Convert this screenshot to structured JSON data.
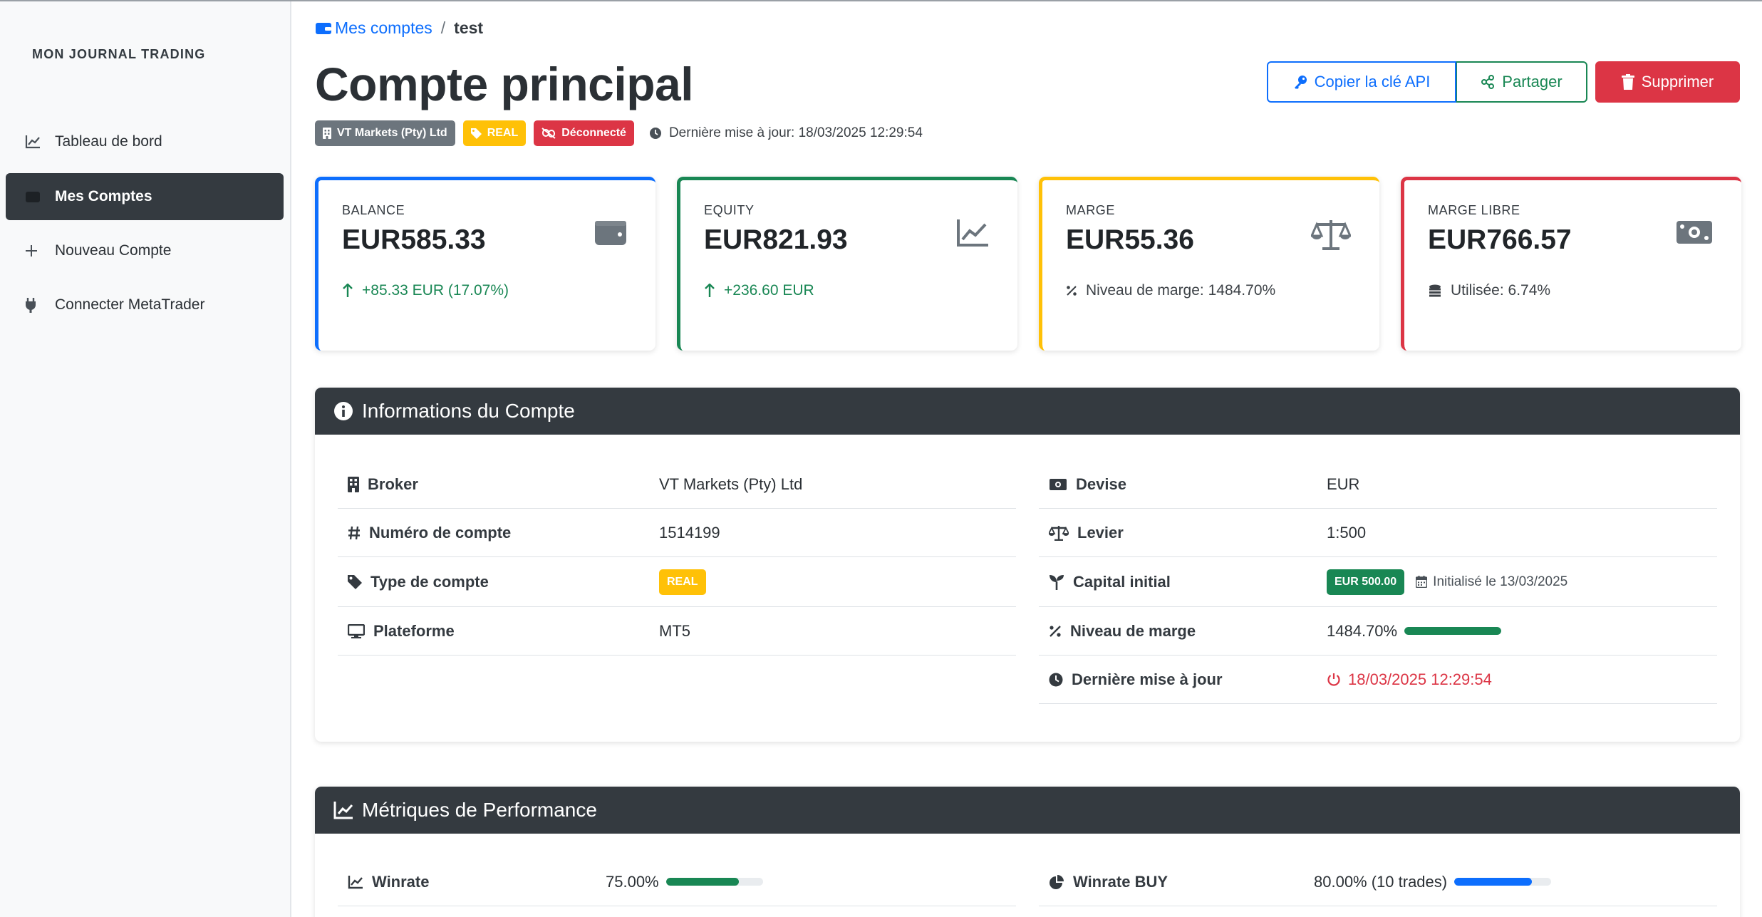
{
  "sidebar": {
    "brand": "MON JOURNAL TRADING",
    "items": [
      {
        "label": "Tableau de bord",
        "icon": "chart-line-icon"
      },
      {
        "label": "Mes Comptes",
        "icon": "wallet-icon",
        "active": true
      },
      {
        "label": "Nouveau Compte",
        "icon": "plus-icon"
      },
      {
        "label": "Connecter MetaTrader",
        "icon": "plug-icon"
      }
    ]
  },
  "breadcrumb": {
    "parent": "Mes comptes",
    "separator": "/",
    "current": "test"
  },
  "header": {
    "title": "Compte principal",
    "badges": {
      "broker": "VT Markets (Pty) Ltd",
      "type": "REAL",
      "status": "Déconnecté"
    },
    "updated": "Dernière mise à jour: 18/03/2025 12:29:54",
    "buttons": {
      "api": "Copier la clé API",
      "share": "Partager",
      "delete": "Supprimer"
    }
  },
  "stats": [
    {
      "label": "BALANCE",
      "value": "EUR585.33",
      "sub": "+85.33 EUR (17.07%)",
      "color": "#0d6efd"
    },
    {
      "label": "EQUITY",
      "value": "EUR821.93",
      "sub": "+236.60 EUR",
      "color": "#198754"
    },
    {
      "label": "MARGE",
      "value": "EUR55.36",
      "sub": "Niveau de marge: 1484.70%",
      "color": "#ffc107"
    },
    {
      "label": "MARGE LIBRE",
      "value": "EUR766.57",
      "sub": "Utilisée: 6.74%",
      "color": "#dc3545"
    }
  ],
  "info": {
    "title": "Informations du Compte",
    "left": [
      {
        "key": "Broker",
        "value": "VT Markets (Pty) Ltd"
      },
      {
        "key": "Numéro de compte",
        "value": "1514199"
      },
      {
        "key": "Type de compte",
        "value": "REAL"
      },
      {
        "key": "Plateforme",
        "value": "MT5"
      }
    ],
    "right": [
      {
        "key": "Devise",
        "value": "EUR"
      },
      {
        "key": "Levier",
        "value": "1:500"
      },
      {
        "key": "Capital initial",
        "value": "EUR 500.00",
        "note": "Initialisé le 13/03/2025"
      },
      {
        "key": "Niveau de marge",
        "value": "1484.70%",
        "progress": 1.0
      },
      {
        "key": "Dernière mise à jour",
        "value": "18/03/2025 12:29:54"
      }
    ]
  },
  "performance": {
    "title": "Métriques de Performance",
    "left": [
      {
        "key": "Winrate",
        "value": "75.00%",
        "progress": 0.75
      }
    ],
    "right": [
      {
        "key": "Winrate BUY",
        "value": "80.00% (10 trades)",
        "progress": 0.8
      }
    ]
  }
}
